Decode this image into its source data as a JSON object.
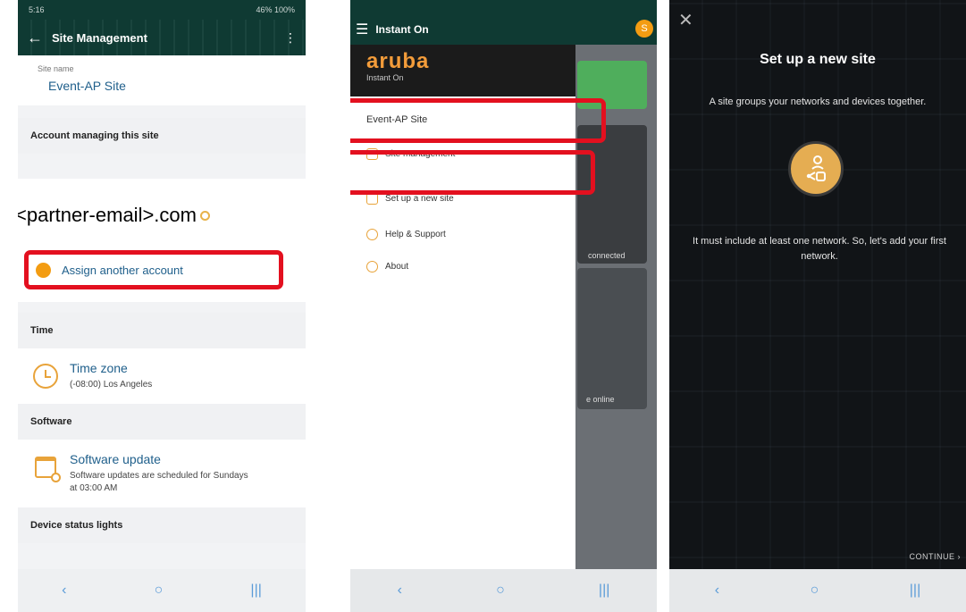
{
  "phone1": {
    "status_time": "5:16",
    "status_right": "46% 100%",
    "title": "Site Management",
    "site_name_label": "Site name",
    "site_name": "Event-AP Site",
    "account_section": "Account managing this site",
    "email": "<partner-email>.com",
    "assign_label": "Assign another account",
    "time_section": "Time",
    "timezone_title": "Time zone",
    "timezone_value": "(-08:00) Los Angeles",
    "software_section": "Software",
    "software_title": "Software update",
    "software_sub": "Software updates are scheduled for Sundays at 03:00 AM",
    "status_lights_section": "Device status lights"
  },
  "phone2": {
    "app_title": "Instant On",
    "avatar_letter": "S",
    "logo": "aruba",
    "logo_sub": "Instant On",
    "site": "Event-AP Site",
    "menu": [
      {
        "label": "Site management"
      },
      {
        "label": "Set up a new site"
      },
      {
        "label": "Help & Support"
      },
      {
        "label": "About"
      }
    ],
    "bg_card_text1": "connected",
    "bg_card_text2": "e online"
  },
  "phone3": {
    "title": "Set up a new site",
    "desc1": "A site groups your networks and devices together.",
    "desc2": "It must include at least one network. So, let's add your first network.",
    "continue_label": "CONTINUE"
  },
  "navbar": {
    "back": "‹",
    "home": "○",
    "recents": "|||"
  },
  "colors": {
    "accent_red": "#e3101f",
    "brand_orange": "#f39c12",
    "header_green": "#0f3a33",
    "link_blue": "#1f5f8b"
  }
}
